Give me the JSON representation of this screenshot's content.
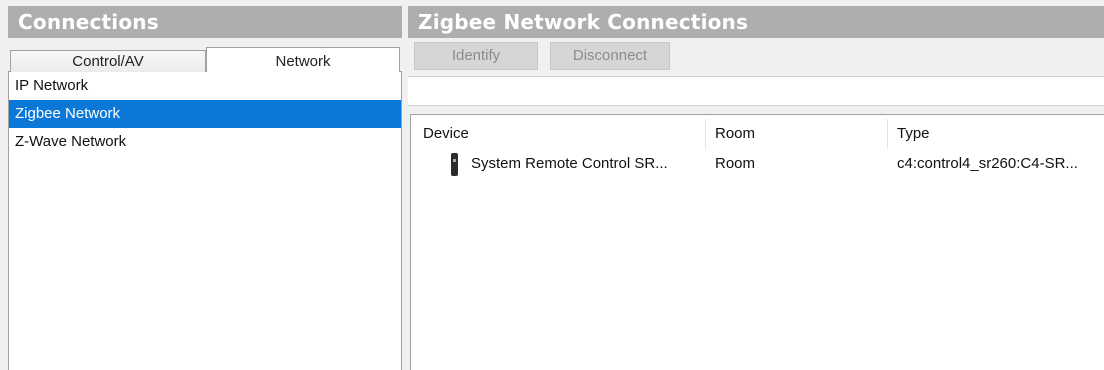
{
  "left": {
    "title": "Connections",
    "tabs": [
      {
        "label": "Control/AV",
        "active": false
      },
      {
        "label": "Network",
        "active": true
      }
    ],
    "items": [
      {
        "label": "IP Network",
        "selected": false
      },
      {
        "label": "Zigbee Network",
        "selected": true
      },
      {
        "label": "Z-Wave Network",
        "selected": false
      }
    ]
  },
  "right": {
    "title": "Zigbee Network Connections",
    "toolbar": {
      "identify_label": "Identify",
      "disconnect_label": "Disconnect"
    },
    "columns": [
      "Device",
      "Room",
      "Type"
    ],
    "rows": [
      {
        "icon": "remote-control-icon",
        "device": "System Remote Control SR...",
        "room": "Room",
        "type": "c4:control4_sr260:C4-SR..."
      }
    ]
  },
  "colors": {
    "header_bg": "#aeaeae",
    "selection": "#0b78d7",
    "disabled_button_bg": "#d6d6d6"
  }
}
